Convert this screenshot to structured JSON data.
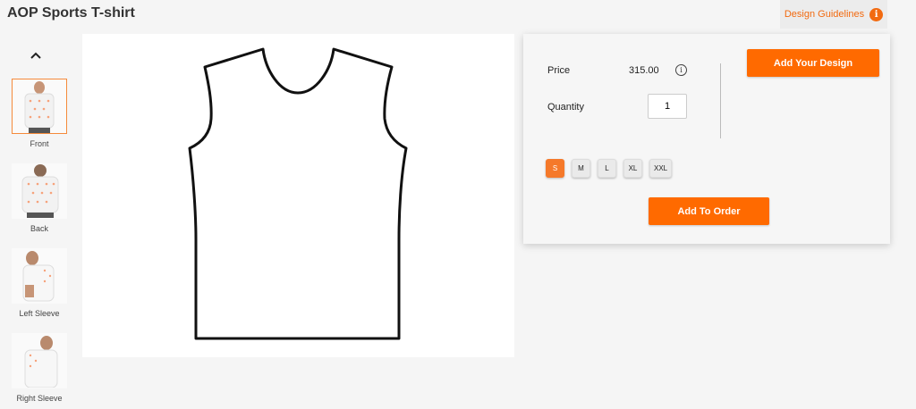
{
  "header": {
    "title": "AOP Sports T-shirt",
    "guidelines_label": "Design Guidelines",
    "guidelines_icon": "info-icon"
  },
  "views": [
    {
      "label": "Front",
      "active": true
    },
    {
      "label": "Back",
      "active": false
    },
    {
      "label": "Left Sleeve",
      "active": false
    },
    {
      "label": "Right Sleeve",
      "active": false
    }
  ],
  "panel": {
    "price_label": "Price",
    "price_value": "315.00",
    "quantity_label": "Quantity",
    "quantity_value": "1",
    "add_design_label": "Add Your Design",
    "sizes": [
      "S",
      "M",
      "L",
      "XL",
      "XXL"
    ],
    "selected_size": "S",
    "add_order_label": "Add To Order"
  },
  "colors": {
    "accent": "#ff6a00",
    "selected_size": "#f5792a"
  }
}
